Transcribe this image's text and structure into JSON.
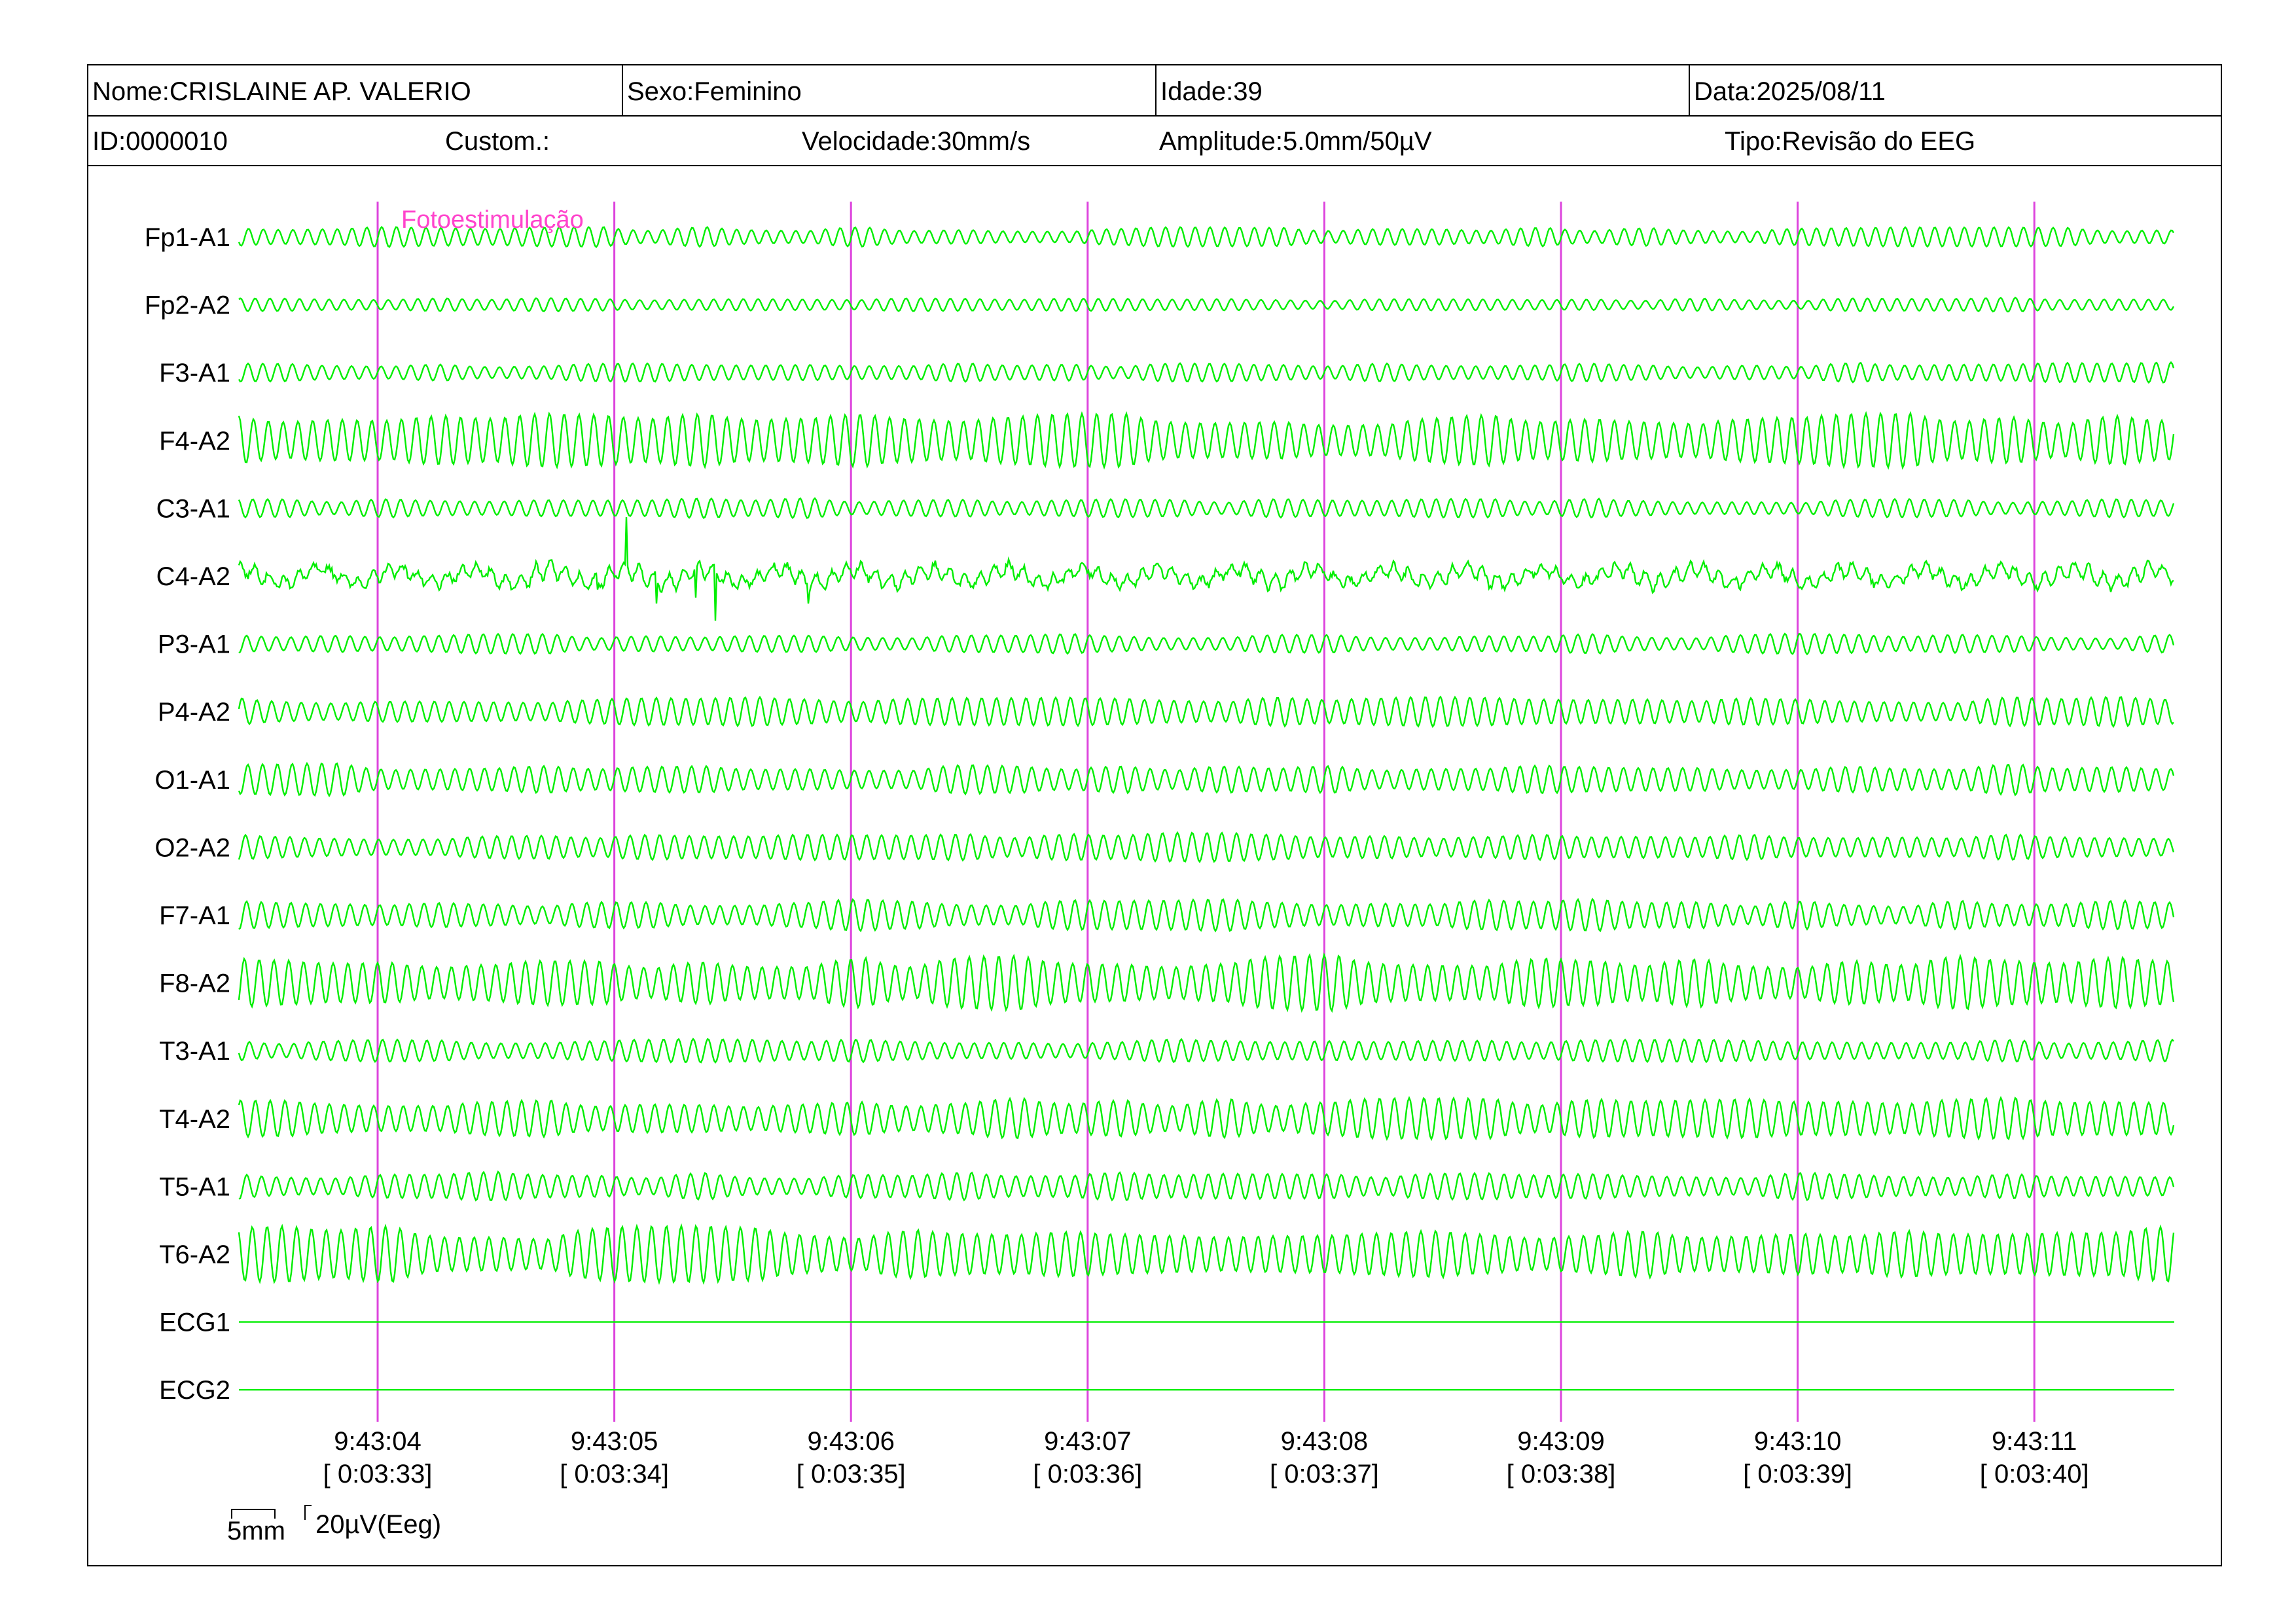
{
  "header": {
    "nome": "Nome:CRISLAINE AP. VALERIO",
    "sexo": "Sexo:Feminino",
    "idade": "Idade:39",
    "data": "Data:2025/08/11",
    "id": "ID:0000010",
    "custom": "Custom.:",
    "velocidade": "Velocidade:30mm/s",
    "amplitude": "Amplitude:5.0mm/50µV",
    "tipo": "Tipo:Revisão do EEG"
  },
  "event_label": "Fotoestimulação",
  "scale": {
    "time": "5mm",
    "amp": "20µV(Eeg)"
  },
  "colors": {
    "trace": "#00ee00",
    "marker": "#dd44dd",
    "event": "#ff44cc",
    "text": "#000000"
  },
  "chart_data": {
    "type": "line",
    "channels": [
      "Fp1-A1",
      "Fp2-A2",
      "F3-A1",
      "F4-A2",
      "C3-A1",
      "C4-A2",
      "P3-A1",
      "P4-A2",
      "O1-A1",
      "O2-A2",
      "F7-A1",
      "F8-A2",
      "T3-A1",
      "T4-A2",
      "T5-A1",
      "T6-A2",
      "ECG1",
      "ECG2"
    ],
    "time_ticks": [
      {
        "clock": "9:43:04",
        "elapsed": "[ 0:03:33]"
      },
      {
        "clock": "9:43:05",
        "elapsed": "[ 0:03:34]"
      },
      {
        "clock": "9:43:06",
        "elapsed": "[ 0:03:35]"
      },
      {
        "clock": "9:43:07",
        "elapsed": "[ 0:03:36]"
      },
      {
        "clock": "9:43:08",
        "elapsed": "[ 0:03:37]"
      },
      {
        "clock": "9:43:09",
        "elapsed": "[ 0:03:38]"
      },
      {
        "clock": "9:43:10",
        "elapsed": "[ 0:03:39]"
      },
      {
        "clock": "9:43:11",
        "elapsed": "[ 0:03:40]"
      }
    ],
    "frequency_hz": 16,
    "amplitude_uv": [
      14,
      10,
      14,
      38,
      14,
      12,
      14,
      22,
      22,
      20,
      22,
      38,
      16,
      28,
      20,
      40,
      0,
      0
    ],
    "event": {
      "label": "Fotoestimulação",
      "time": "9:43:04"
    }
  }
}
